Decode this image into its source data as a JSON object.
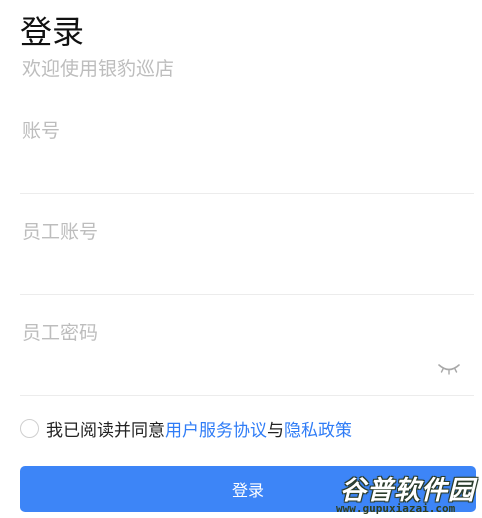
{
  "header": {
    "title": "登录",
    "subtitle": "欢迎使用银豹巡店"
  },
  "form": {
    "account_placeholder": "账号",
    "employee_placeholder": "员工账号",
    "password_placeholder": "员工密码",
    "password_toggle_icon": "eye-closed-icon"
  },
  "agreement": {
    "prefix": "我已阅读并同意",
    "terms_link": "用户服务协议",
    "connector": "与",
    "privacy_link": "隐私政策"
  },
  "login_button": {
    "label": "登录"
  },
  "watermark": {
    "brand": "谷普软件园",
    "url": "www.gupuxiazai.com"
  },
  "colors": {
    "primary": "#3d85f7",
    "link": "#2f7cf6",
    "placeholder": "#bdbdbd"
  }
}
